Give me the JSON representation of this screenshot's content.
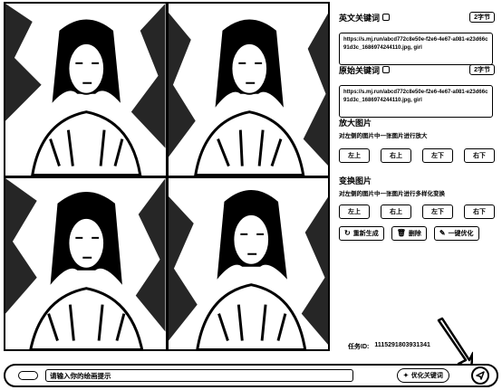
{
  "panel": {
    "en_keywords": {
      "title": "英文关键词",
      "count_label": "2字节",
      "prompt_text": "https://s.mj.run/abcd772c8e50e-f2e6-4e67-a081-e23d66c91d3c_1686974244110.jpg, girl"
    },
    "original_keywords": {
      "title": "原始关键词",
      "count_label": "2字节",
      "prompt_text": "https://s.mj.run/abcd772c8e50e-f2e6-4e67-a081-e23d66c91d3c_1686974244110.jpg, girl"
    },
    "upscale": {
      "title": "放大图片",
      "hint": "对左侧的图片中一张图片进行放大",
      "buttons": [
        "左上",
        "右上",
        "左下",
        "右下"
      ]
    },
    "variation": {
      "title": "变换图片",
      "hint": "对左侧的图片中一张图片进行多样化变换",
      "buttons": [
        "左上",
        "右上",
        "左下",
        "右下"
      ]
    },
    "actions": {
      "regenerate": "重新生成",
      "delete": "删除",
      "refine": "一键优化"
    },
    "task": {
      "label": "任务ID:",
      "value": "1115291803931341"
    }
  },
  "bar": {
    "placeholder": "请输入你的绘画提示",
    "keyword_button": "优化关键词"
  },
  "icons": {
    "copy": "copy-icon",
    "regenerate": "refresh-icon",
    "delete": "trash-icon",
    "refine": "wand-icon",
    "send": "send-icon",
    "cursor": "arrow-cursor-icon"
  }
}
